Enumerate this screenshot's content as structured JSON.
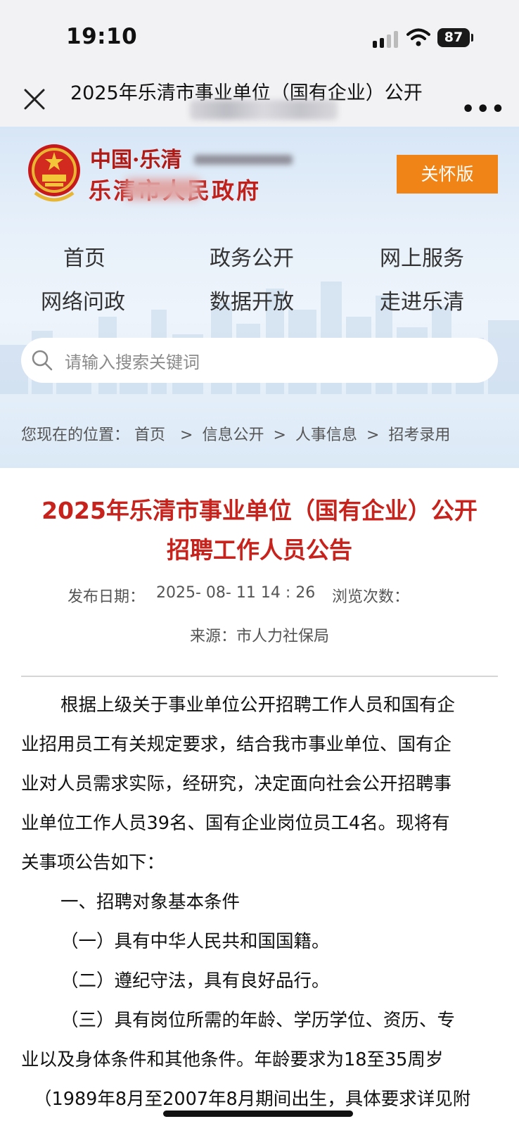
{
  "status_bar": {
    "time": "19:10",
    "battery": "87",
    "icons": [
      "signal-icon",
      "wifi-icon",
      "battery-icon"
    ]
  },
  "nav": {
    "title": "2025年乐清市事业单位（国有企业）公开",
    "close_icon": "close-icon",
    "more_icon": "more-icon"
  },
  "header": {
    "logo_line1": "中国·乐清",
    "logo_line2": "乐清市人民政府",
    "care_button": "关怀版",
    "menu": [
      "首页",
      "政务公开",
      "网上服务",
      "网络问政",
      "数据开放",
      "走进乐清"
    ],
    "search_placeholder": "请输入搜索关键词"
  },
  "breadcrumb": {
    "prefix": "您现在的位置：",
    "items": [
      "首页",
      "信息公开",
      "人事信息",
      "招考录用"
    ],
    "separator": ">"
  },
  "article": {
    "title_line1": "2025年乐清市事业单位（国有企业）公开",
    "title_line2": "招聘工作人员公告",
    "date_label": "发布日期：",
    "date_value": "2025- 08- 11 14 : 26",
    "views_label": "浏览次数：",
    "source": "来源：市人力社保局",
    "paragraphs": [
      "根据上级关于事业单位公开招聘工作人员和国有企",
      "业招用员工有关规定要求，结合我市事业单位、国有企",
      "业对人员需求实际，经研究，决定面向社会公开招聘事",
      "业单位工作人员39名、国有企业岗位员工4名。现将有",
      "关事项公告如下：",
      "一、招聘对象基本条件",
      "（一）具有中华人民共和国国籍。",
      "（二）遵纪守法，具有良好品行。",
      "（三）具有岗位所需的年龄、学历学位、资历、专",
      "业以及身体条件和其他条件。年龄要求为18至35周岁",
      "（1989年8月至2007年8月期间出生，具体要求详见附"
    ]
  },
  "colors": {
    "accent_red": "#c7221b",
    "care_orange": "#f08416",
    "header_bg": "#e7f0fa"
  }
}
